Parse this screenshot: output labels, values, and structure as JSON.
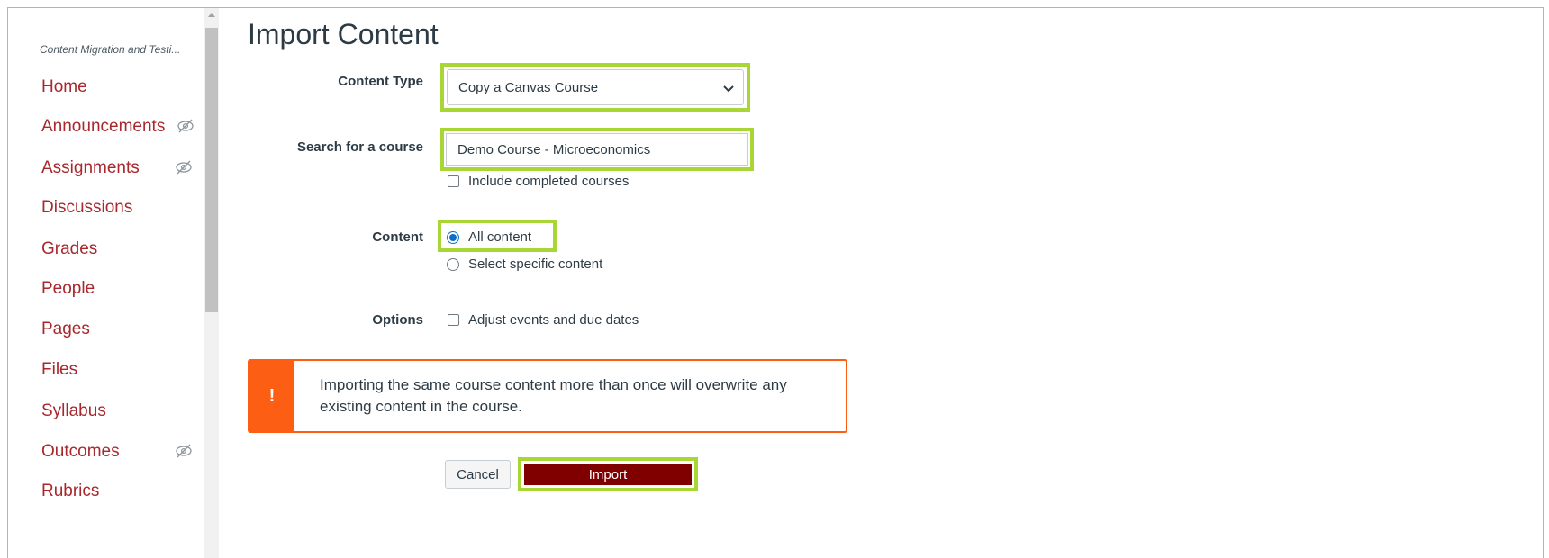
{
  "sidebar": {
    "course_name": "Content Migration and Testi...",
    "items": [
      {
        "label": "Home",
        "hidden": false
      },
      {
        "label": "Announcements",
        "hidden": true
      },
      {
        "label": "Assignments",
        "hidden": true
      },
      {
        "label": "Discussions",
        "hidden": false
      },
      {
        "label": "Grades",
        "hidden": false
      },
      {
        "label": "People",
        "hidden": false
      },
      {
        "label": "Pages",
        "hidden": false
      },
      {
        "label": "Files",
        "hidden": false
      },
      {
        "label": "Syllabus",
        "hidden": false
      },
      {
        "label": "Outcomes",
        "hidden": true
      },
      {
        "label": "Rubrics",
        "hidden": false
      }
    ]
  },
  "main": {
    "title": "Import Content",
    "content_type": {
      "label": "Content Type",
      "selected": "Copy a Canvas Course"
    },
    "search": {
      "label": "Search for a course",
      "value": "Demo Course - Microeconomics",
      "include_completed_label": "Include completed courses",
      "include_completed_checked": false
    },
    "content": {
      "label": "Content",
      "options": [
        {
          "label": "All content",
          "selected": true
        },
        {
          "label": "Select specific content",
          "selected": false
        }
      ]
    },
    "options": {
      "label": "Options",
      "adjust_label": "Adjust events and due dates",
      "adjust_checked": false
    },
    "alert": {
      "icon": "warning-icon",
      "text": "Importing the same course content more than once will overwrite any existing content in the course."
    },
    "buttons": {
      "cancel": "Cancel",
      "import": "Import"
    }
  },
  "colors": {
    "nav_link": "#a8282d",
    "highlight": "#a8d634",
    "alert_orange": "#fc5e13",
    "import_button": "#800000",
    "radio_selected": "#0b6ec8"
  }
}
